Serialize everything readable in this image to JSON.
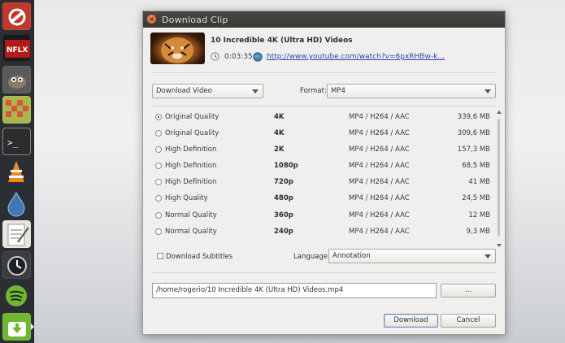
{
  "launcher": {
    "items": [
      {
        "name": "system-settings-icon",
        "color": "#c0392b"
      },
      {
        "name": "netflix-icon",
        "color": "#b31b1b"
      },
      {
        "name": "gimp-icon",
        "color": "#6b6b6b"
      },
      {
        "name": "checkers-icon",
        "color": "#a9b84a"
      },
      {
        "name": "terminal-icon",
        "color": "#2c2c2c"
      },
      {
        "name": "vlc-icon",
        "color": "#f08a1d"
      },
      {
        "name": "water-drop-icon",
        "color": "#3f78b5"
      },
      {
        "name": "text-editor-icon",
        "color": "#d9d6cf"
      },
      {
        "name": "clock-app-icon",
        "color": "#3a3d40"
      },
      {
        "name": "spotify-icon",
        "color": "#6fb631"
      },
      {
        "name": "download-app-icon",
        "color": "#6fb631"
      }
    ]
  },
  "dialog": {
    "title": "Download Clip",
    "close_symbol": "×",
    "video": {
      "title": "10 Incredible 4K (Ultra HD) Videos",
      "duration": "0:03:35",
      "url": "http://www.youtube.com/watch?v=6pxRHBw-k..."
    },
    "download_type": {
      "selected": "Download Video"
    },
    "format": {
      "label": "Format:",
      "selected": "MP4"
    },
    "qualities": [
      {
        "quality": "Original Quality",
        "resolution": "4K",
        "format": "MP4 / H264 / AAC",
        "size": "339,6 MB",
        "selected": true
      },
      {
        "quality": "Original Quality",
        "resolution": "4K",
        "format": "MP4 / H264 / AAC",
        "size": "309,6 MB",
        "selected": false
      },
      {
        "quality": "High Definition",
        "resolution": "2K",
        "format": "MP4 / H264 / AAC",
        "size": "157,3 MB",
        "selected": false
      },
      {
        "quality": "High Definition",
        "resolution": "1080p",
        "format": "MP4 / H264 / AAC",
        "size": "68,5 MB",
        "selected": false
      },
      {
        "quality": "High Definition",
        "resolution": "720p",
        "format": "MP4 / H264 / AAC",
        "size": "41 MB",
        "selected": false
      },
      {
        "quality": "High Quality",
        "resolution": "480p",
        "format": "MP4 / H264 / AAC",
        "size": "24,5 MB",
        "selected": false
      },
      {
        "quality": "Normal Quality",
        "resolution": "360p",
        "format": "MP4 / H264 / AAC",
        "size": "12 MB",
        "selected": false
      },
      {
        "quality": "Normal Quality",
        "resolution": "240p",
        "format": "MP4 / H264 / AAC",
        "size": "9,3 MB",
        "selected": false
      }
    ],
    "subtitles": {
      "label": "Download Subtitles",
      "checked": false
    },
    "language": {
      "label": "Language:",
      "selected": "Annotation"
    },
    "save_path": "/home/rogerio/10 Incredible 4K (Ultra HD) Videos.mp4",
    "browse_label": "...",
    "download_label": "Download",
    "cancel_label": "Cancel"
  }
}
